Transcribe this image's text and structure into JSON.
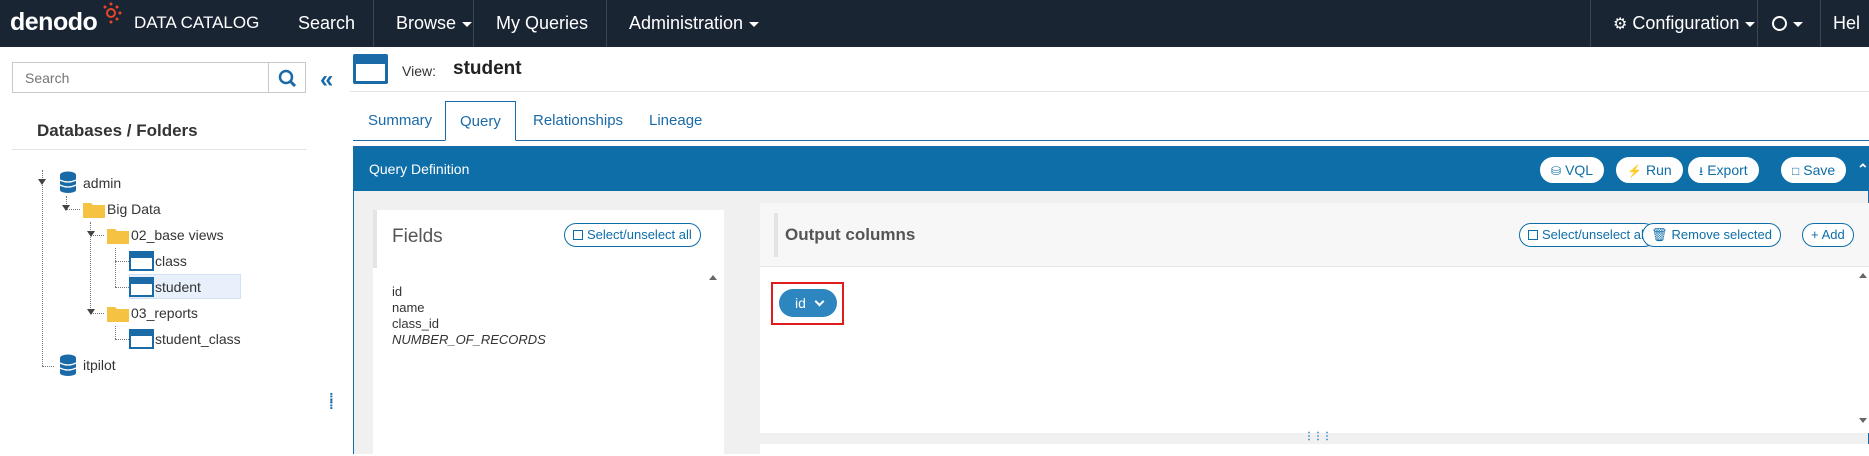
{
  "brand": {
    "logo": "denodo",
    "product": "DATA CATALOG"
  },
  "nav": {
    "search": "Search",
    "browse": "Browse",
    "my_queries": "My Queries",
    "administration": "Administration",
    "configuration": "Configuration",
    "help": "Hel"
  },
  "sidebar": {
    "search_placeholder": "Search",
    "title": "Databases / Folders",
    "tree": {
      "admin": "admin",
      "big_data": "Big Data",
      "base_views": "02_base views",
      "class": "class",
      "student": "student",
      "reports": "03_reports",
      "student_class": "student_class",
      "itpilot": "itpilot"
    }
  },
  "view": {
    "label": "View:",
    "name": "student"
  },
  "tabs": [
    "Summary",
    "Query",
    "Relationships",
    "Lineage"
  ],
  "active_tab": "Query",
  "query_definition": {
    "title": "Query Definition",
    "buttons": {
      "vql": "VQL",
      "run": "Run",
      "export": "Export",
      "save": "Save"
    }
  },
  "fields": {
    "title": "Fields",
    "select_all": "Select/unselect all",
    "items": [
      "id",
      "name",
      "class_id",
      "NUMBER_OF_RECORDS"
    ]
  },
  "output": {
    "title": "Output columns",
    "select_all": "Select/unselect all",
    "remove_selected": "Remove selected",
    "add": "Add",
    "columns": [
      "id"
    ]
  },
  "colors": {
    "nav_bg": "#1a2533",
    "accent": "#0e6ea8",
    "highlight": "#e01b1b"
  }
}
